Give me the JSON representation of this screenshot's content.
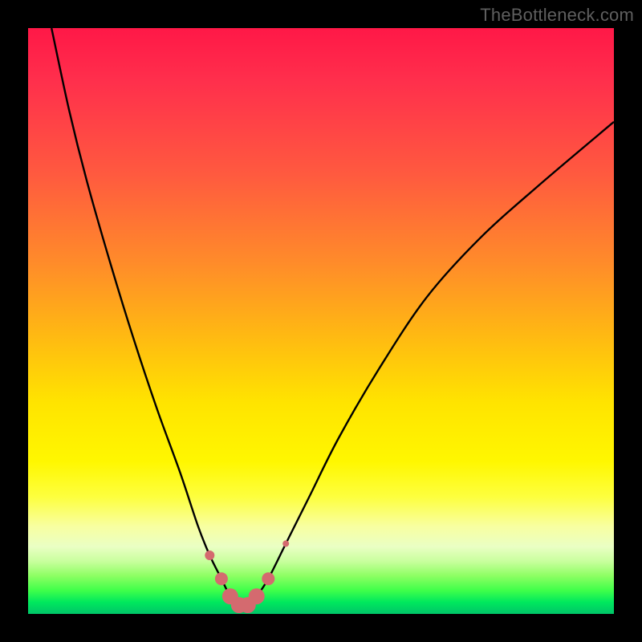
{
  "watermark": "TheBottleneck.com",
  "chart_data": {
    "type": "line",
    "title": "",
    "xlabel": "",
    "ylabel": "",
    "xlim": [
      0,
      100
    ],
    "ylim": [
      0,
      100
    ],
    "grid": false,
    "legend": false,
    "series": [
      {
        "name": "curve",
        "x": [
          4,
          7,
          10,
          14,
          18,
          22,
          26,
          29,
          31,
          33,
          34.5,
          36,
          37.5,
          39,
          41,
          44,
          48,
          53,
          60,
          68,
          77,
          87,
          100
        ],
        "y": [
          100,
          86,
          74,
          60,
          47,
          35,
          24,
          15,
          10,
          6,
          3,
          1.5,
          1.5,
          3,
          6,
          12,
          20,
          30,
          42,
          54,
          64,
          73,
          84
        ]
      }
    ],
    "markers": {
      "name": "highlight-points",
      "color": "#d46a6f",
      "x": [
        31,
        33,
        34.5,
        36,
        37.5,
        39,
        41,
        44
      ],
      "y": [
        10,
        6,
        3,
        1.5,
        1.5,
        3,
        6,
        12
      ],
      "sizes": [
        6,
        8,
        10,
        10,
        10,
        10,
        8,
        4
      ]
    }
  },
  "colors": {
    "background": "#000000",
    "curve": "#000000",
    "marker": "#d46a6f",
    "watermark": "#5f5f5f"
  }
}
